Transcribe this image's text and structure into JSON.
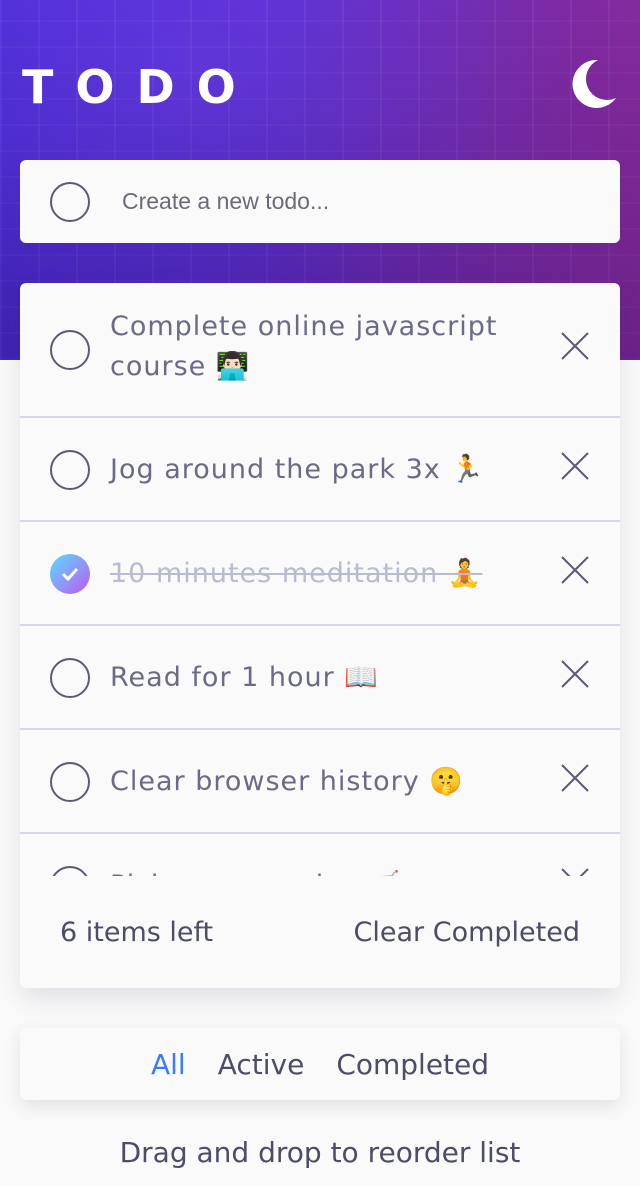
{
  "app": {
    "title": "TODO",
    "theme_icon": "moon-icon"
  },
  "new_todo": {
    "placeholder": "Create a new todo..."
  },
  "todos": [
    {
      "label": "Complete online javascript course 👨🏻‍💻",
      "completed": false
    },
    {
      "label": "Jog around the park 3x 🏃",
      "completed": false
    },
    {
      "label": "10 minutes meditation 🧘",
      "completed": true
    },
    {
      "label": "Read for 1 hour 📖",
      "completed": false
    },
    {
      "label": "Clear browser history 🤫",
      "completed": false
    },
    {
      "label": "Pick up groceries 🛒",
      "completed": false
    }
  ],
  "footer": {
    "items_left": "6 items left",
    "clear_completed": "Clear Completed"
  },
  "filters": {
    "all": "All",
    "active": "Active",
    "completed": "Completed",
    "selected": "All"
  },
  "hint": "Drag and drop to reorder list",
  "colors": {
    "accent": "#3a7bfd",
    "check_gradient_start": "#57ddff",
    "check_gradient_end": "#c058f3",
    "text": "#4c4d66"
  }
}
